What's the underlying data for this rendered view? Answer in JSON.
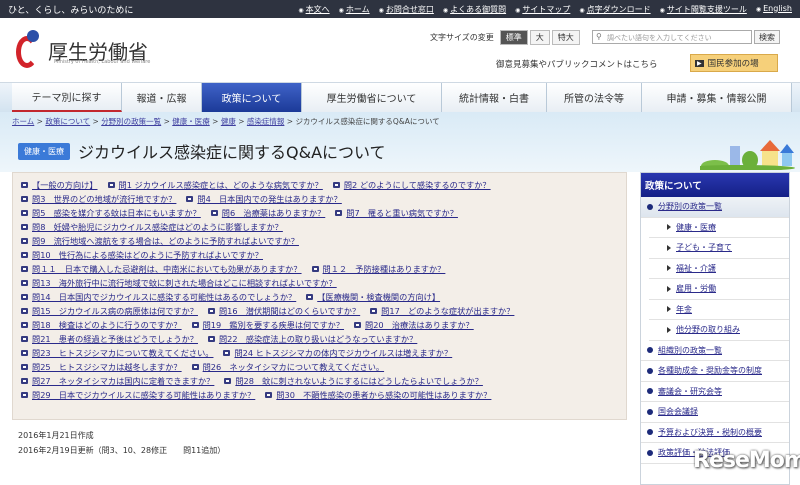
{
  "topbar": {
    "tagline": "ひと、くらし、みらいのために",
    "links": [
      "本文へ",
      "ホーム",
      "お問合せ窓口",
      "よくある御質問",
      "サイトマップ",
      "点字ダウンロード",
      "サイト閲覧支援ツール",
      "English"
    ]
  },
  "header": {
    "logo_jp": "厚生労働省",
    "logo_en": "Ministry of Health, Labour and Welfare",
    "fontsize_label": "文字サイズの変更",
    "fontsize_options": [
      "標準",
      "大",
      "特大"
    ],
    "search_placeholder": "調べたい語句を入力してください",
    "search_button": "検索",
    "public_comment": "御意見募集やパブリックコメントはこちら",
    "kokumin_button": "国民参加の場"
  },
  "nav": [
    "テーマ別に探す",
    "報道・広報",
    "政策について",
    "厚生労働省について",
    "統計情報・白書",
    "所管の法令等",
    "申請・募集・情報公開"
  ],
  "breadcrumb": [
    "ホーム",
    "政策について",
    "分野別の政策一覧",
    "健康・医療",
    "健康",
    "感染症情報",
    "ジカウイルス感染症に関するQ&Aについて"
  ],
  "page": {
    "category_badge": "健康・医療",
    "title": "ジカウイルス感染症に関するQ&Aについて"
  },
  "qa": {
    "rows": [
      [
        "【一般の方向け】",
        "問1 ジカウイルス感染症とは、どのような病気ですか？",
        "問2 どのようにして感染するのですか？"
      ],
      [
        "問3　世界のどの地域が流行地ですか？",
        "問4　日本国内での発生はありますか？"
      ],
      [
        "問5　感染を媒介する蚊は日本にもいますか？",
        "問6　治療薬はありますか？",
        "問7　罹ると重い病気ですか？"
      ],
      [
        "問8　妊婦や胎児にジカウイルス感染症はどのように影響しますか？"
      ],
      [
        "問9　流行地域へ渡航をする場合は、どのように予防すればよいですか？"
      ],
      [
        "問10　性行為による感染はどのように予防すればよいですか？"
      ],
      [
        "問１１　日本で購入した忌避剤は、中南米においても効果がありますか？",
        "問１２　予防接種はありますか？"
      ],
      [
        "問13　海外旅行中に流行地域で蚊に刺された場合はどこに相談すればよいですか？"
      ],
      [
        "問14　日本国内でジカウイルスに感染する可能性はあるのでしょうか？",
        "【医療機関・検査機関の方向け】"
      ],
      [
        "問15　ジカウイルス病の病原体は何ですか？",
        "問16　潜伏期間はどのくらいですか？",
        "問17　どのような症状が出ますか？"
      ],
      [
        "問18　検査はどのように行うのですか？",
        "問19　鑑別を要する疾患は何ですか？",
        "問20　治療法はありますか？"
      ],
      [
        "問21　患者の経過と予後はどうでしょうか？",
        "問22　感染症法上の取り扱いはどうなっていますか？"
      ],
      [
        "問23　ヒトスジシマカについて教えてください。",
        "問24 ヒトスジシマカの体内でジカウイルスは増えますか？"
      ],
      [
        "問25　ヒトスジシマカは越冬しますか？",
        "問26　ネッタイシマカについて教えてください。"
      ],
      [
        "問27　ネッタイシマカは国内に定着できますか？",
        "問28　蚊に刺されないようにするにはどうしたらよいでしょうか？"
      ],
      [
        "問29　日本でジカウイルスに感染する可能性はありますか？",
        "問30　不顕性感染の患者から感染の可能性はありますか？"
      ]
    ]
  },
  "dates": {
    "created": "2016年1月21日作成",
    "updated": "2016年2月19日更新（問3、10、28修正　　問11追加）"
  },
  "sidebar": {
    "header": "政策について",
    "items": [
      {
        "label": "分野別の政策一覧",
        "level": "top"
      },
      {
        "label": "健康・医療",
        "level": "sub"
      },
      {
        "label": "子ども・子育て",
        "level": "sub"
      },
      {
        "label": "福祉・介護",
        "level": "sub"
      },
      {
        "label": "雇用・労働",
        "level": "sub"
      },
      {
        "label": "年金",
        "level": "sub"
      },
      {
        "label": "他分野の取り組み",
        "level": "sub"
      },
      {
        "label": "組織別の政策一覧",
        "level": "main"
      },
      {
        "label": "各種助成金・奨励金等の制度",
        "level": "main"
      },
      {
        "label": "審議会・研究会等",
        "level": "main"
      },
      {
        "label": "国会会議録",
        "level": "main"
      },
      {
        "label": "予算および決算・税制の概要",
        "level": "main"
      },
      {
        "label": "政策評価・独法評価",
        "level": "main"
      }
    ]
  },
  "watermark": "ReseMom"
}
